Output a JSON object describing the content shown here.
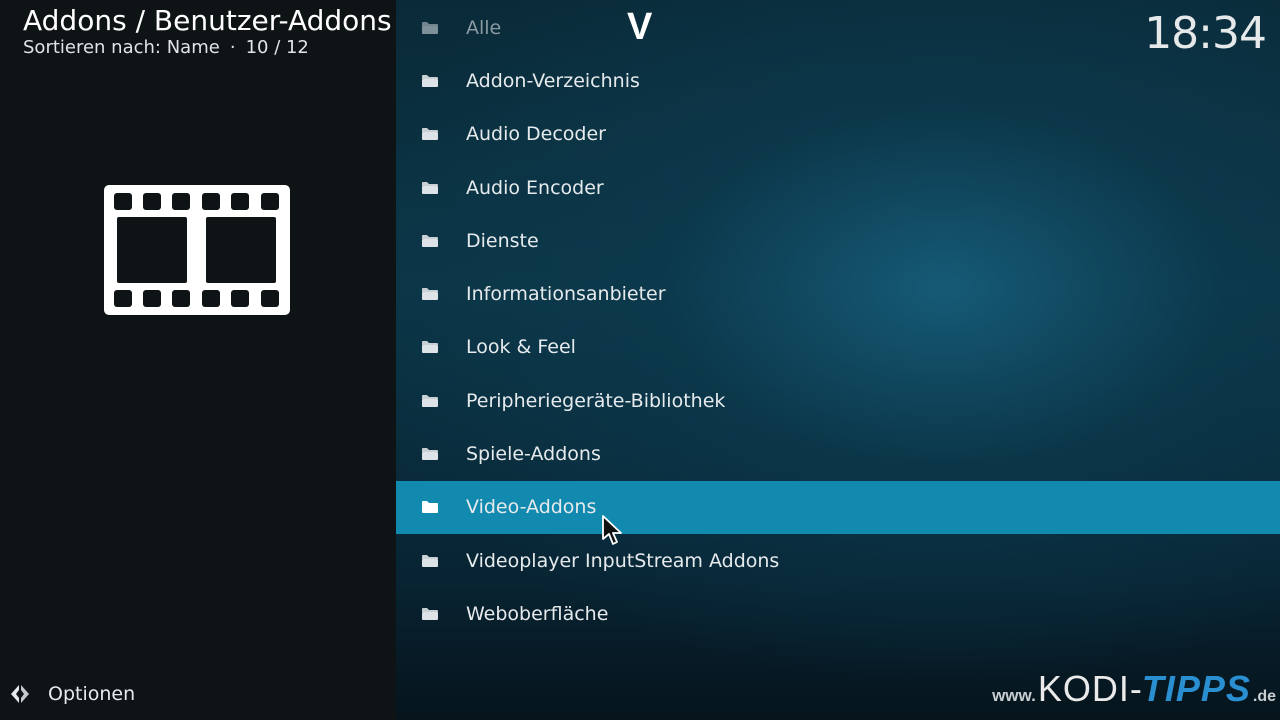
{
  "header": {
    "title": "Addons / Benutzer-Addons",
    "sort_label": "Sortieren nach: Name",
    "separator": "·",
    "position": "10 / 12"
  },
  "clock": "18:34",
  "letter_jump": "V",
  "poster": {
    "icon": "film-strip-icon"
  },
  "list": {
    "items": [
      {
        "label": "Alle",
        "icon": "folder-icon"
      },
      {
        "label": "Addon-Verzeichnis",
        "icon": "folder-icon"
      },
      {
        "label": "Audio Decoder",
        "icon": "folder-icon"
      },
      {
        "label": "Audio Encoder",
        "icon": "folder-icon"
      },
      {
        "label": "Dienste",
        "icon": "folder-icon"
      },
      {
        "label": "Informationsanbieter",
        "icon": "folder-icon"
      },
      {
        "label": "Look & Feel",
        "icon": "folder-icon"
      },
      {
        "label": "Peripheriegeräte-Bibliothek",
        "icon": "folder-icon"
      },
      {
        "label": "Spiele-Addons",
        "icon": "folder-icon"
      },
      {
        "label": "Video-Addons",
        "icon": "folder-open-icon",
        "selected": true
      },
      {
        "label": "Videoplayer InputStream Addons",
        "icon": "folder-icon"
      },
      {
        "label": "Weboberfläche",
        "icon": "folder-icon"
      }
    ]
  },
  "footer": {
    "options_label": "Optionen",
    "options_icon": "options-arrows-icon"
  },
  "watermark": {
    "www": "www.",
    "kodi": "KODI",
    "dash": "-",
    "tipps": "TIPPS",
    "de": ".de"
  },
  "colors": {
    "selection": "#1289ae",
    "left_panel": "#0e1316",
    "watermark_accent": "#2a8fd1"
  }
}
